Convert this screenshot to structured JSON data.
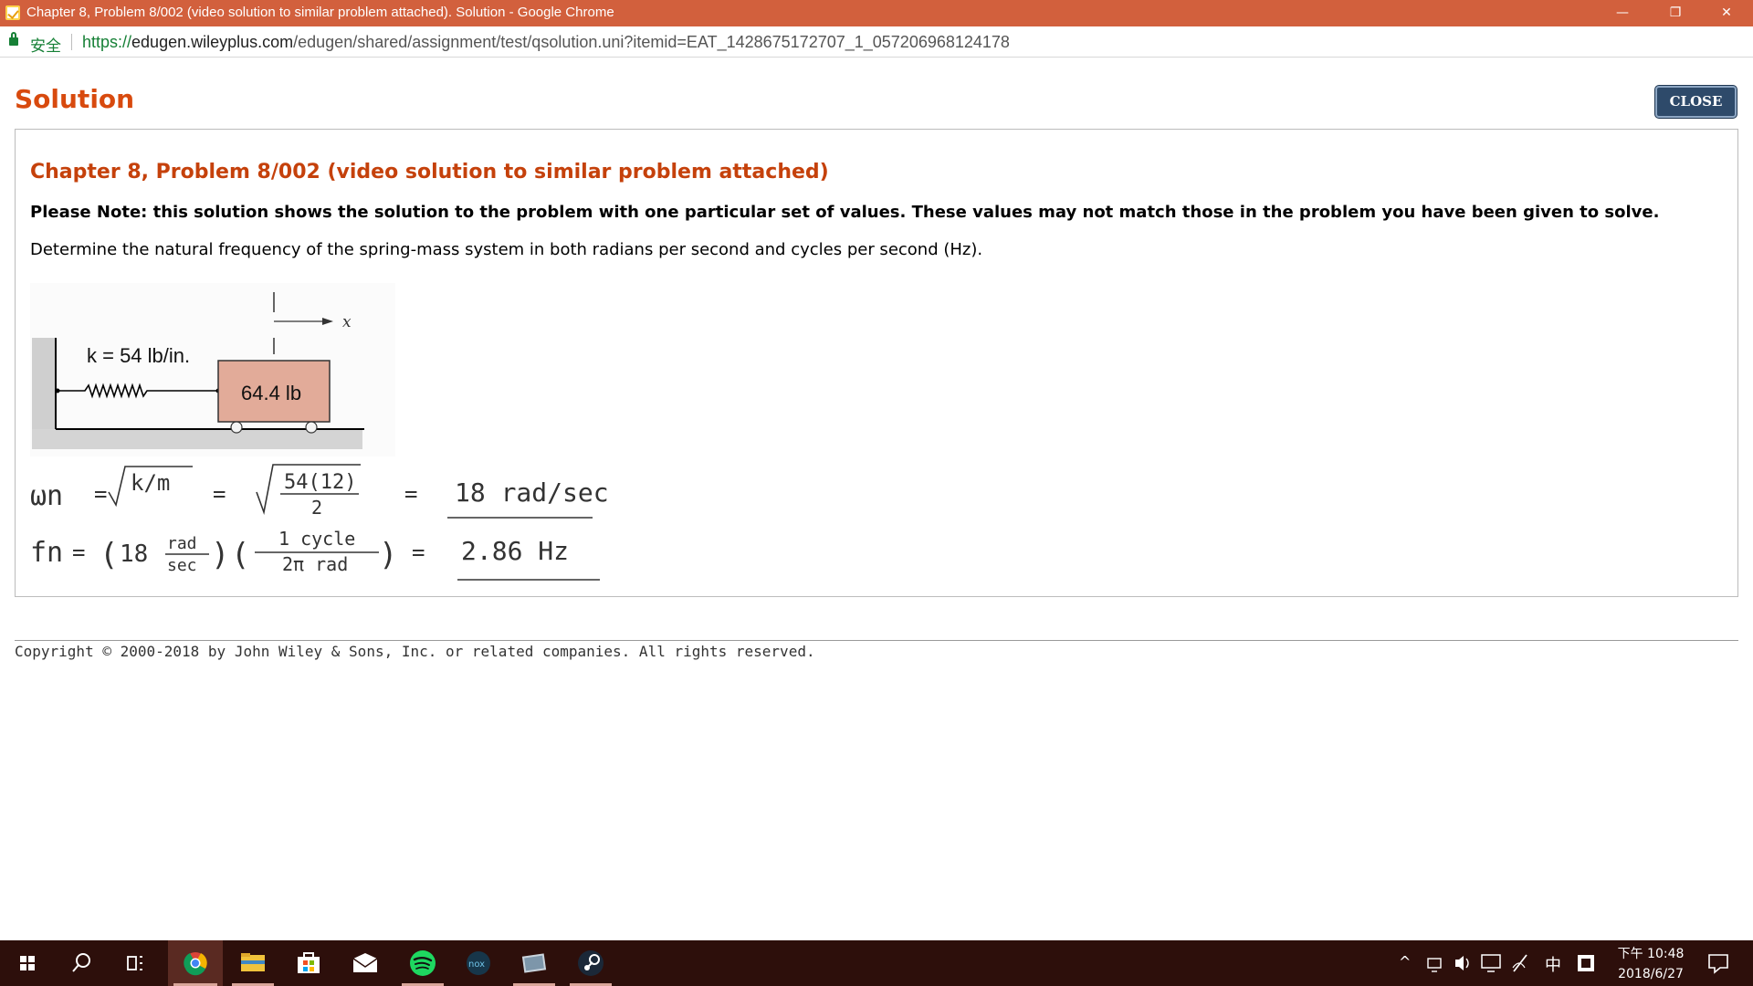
{
  "window": {
    "title": "Chapter 8, Problem 8/002 (video solution to similar problem attached). Solution - Google Chrome",
    "controls": {
      "minimize": "—",
      "restore": "❐",
      "close": "✕"
    }
  },
  "address_bar": {
    "secure_label": "安全",
    "url_scheme": "https://",
    "url_host": "edugen.wileyplus.com",
    "url_path": "/edugen/shared/assignment/test/qsolution.uni?itemid=EAT_1428675172707_1_057206968124178"
  },
  "page": {
    "heading": "Solution",
    "close_label": "CLOSE",
    "problem_title": "Chapter 8, Problem 8/002 (video solution to similar problem attached)",
    "note": "Please Note: this solution shows the solution to the problem with one particular set of values. These values may not match those in the problem you have been given to solve.",
    "statement": "Determine the natural frequency of the spring-mass system in both radians per second and cycles per second (Hz).",
    "copyright": "Copyright © 2000-2018 by John Wiley & Sons, Inc. or related companies. All rights reserved."
  },
  "figure": {
    "spring_label": "k = 54 lb/in.",
    "mass_label": "64.4 lb",
    "axis_label": "x",
    "colors": {
      "block": "#e2ab99",
      "wall": "#cfcfcf"
    }
  },
  "work": {
    "omega": "ωn",
    "eq": "=",
    "sqrt_km": "k/m",
    "numerator": "54(12)",
    "denominator": "2",
    "omega_result": "18 rad/sec",
    "fn": "fn",
    "rate": "18",
    "rad_unit": "rad",
    "sec_unit": "sec",
    "cycle": "1 cycle",
    "two_pi_rad": "2π rad",
    "fn_result": "2.86 Hz"
  },
  "taskbar": {
    "apps": [
      "windows-start-icon",
      "search-icon",
      "task-view-icon",
      "chrome-icon",
      "file-explorer-icon",
      "store-icon",
      "mail-icon",
      "spotify-icon",
      "nox-icon",
      "photos-icon",
      "steam-icon"
    ],
    "nox_label": "nox",
    "tray": {
      "up_arrow": "^",
      "ime": "中"
    },
    "time": "下午 10:48",
    "date": "2018/6/27"
  }
}
